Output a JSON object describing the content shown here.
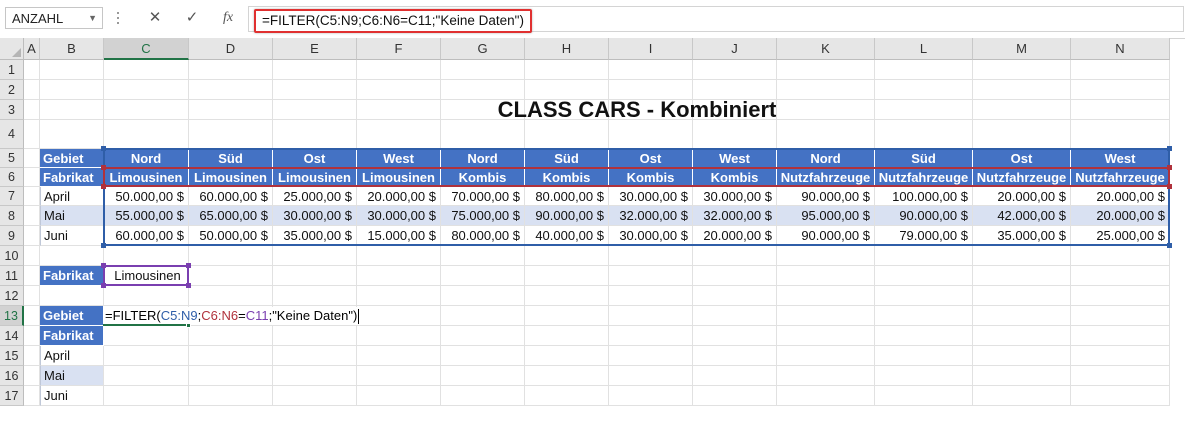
{
  "formula_bar": {
    "name_box": "ANZAHL",
    "cancel_glyph": "✕",
    "enter_glyph": "✓",
    "fx_label": "fx",
    "formula": "=FILTER(C5:N9;C6:N6=C11;\"Keine Daten\")"
  },
  "columns": [
    "A",
    "B",
    "C",
    "D",
    "E",
    "F",
    "G",
    "H",
    "I",
    "J",
    "K",
    "L",
    "M",
    "N"
  ],
  "rows": [
    "1",
    "2",
    "3",
    "4",
    "5",
    "6",
    "7",
    "8",
    "9",
    "10",
    "11",
    "12",
    "13",
    "14",
    "15",
    "16",
    "17"
  ],
  "title": "CLASS CARS - Kombiniert",
  "table": {
    "gebiet_label": "Gebiet",
    "fabrikat_label": "Fabrikat",
    "gebiete": [
      "Nord",
      "Süd",
      "Ost",
      "West",
      "Nord",
      "Süd",
      "Ost",
      "West",
      "Nord",
      "Süd",
      "Ost",
      "West"
    ],
    "fabrikate": [
      "Limousinen",
      "Limousinen",
      "Limousinen",
      "Limousinen",
      "Kombis",
      "Kombis",
      "Kombis",
      "Kombis",
      "Nutzfahrzeuge",
      "Nutzfahrzeuge",
      "Nutzfahrzeuge",
      "Nutzfahrzeuge"
    ],
    "data": [
      {
        "month": "April",
        "values": [
          "50.000,00 $",
          "60.000,00 $",
          "25.000,00 $",
          "20.000,00 $",
          "70.000,00 $",
          "80.000,00 $",
          "30.000,00 $",
          "30.000,00 $",
          "90.000,00 $",
          "100.000,00 $",
          "20.000,00 $",
          "20.000,00 $"
        ]
      },
      {
        "month": "Mai",
        "values": [
          "55.000,00 $",
          "65.000,00 $",
          "30.000,00 $",
          "30.000,00 $",
          "75.000,00 $",
          "90.000,00 $",
          "32.000,00 $",
          "32.000,00 $",
          "95.000,00 $",
          "90.000,00 $",
          "42.000,00 $",
          "20.000,00 $"
        ]
      },
      {
        "month": "Juni",
        "values": [
          "60.000,00 $",
          "50.000,00 $",
          "35.000,00 $",
          "15.000,00 $",
          "80.000,00 $",
          "40.000,00 $",
          "30.000,00 $",
          "20.000,00 $",
          "90.000,00 $",
          "79.000,00 $",
          "35.000,00 $",
          "25.000,00 $"
        ]
      }
    ]
  },
  "criteria": {
    "label": "Fabrikat",
    "value": "Limousinen"
  },
  "result": {
    "gebiet_label": "Gebiet",
    "fabrikat_label": "Fabrikat",
    "months": [
      "April",
      "Mai",
      "Juni"
    ],
    "edit_parts": {
      "p1": "=FILTER(",
      "p2": "C5:N9",
      "p3": ";",
      "p4": "C6:N6",
      "p5": "=",
      "p6": "C11",
      "p7": ";\"Keine Daten\")"
    }
  },
  "colors": {
    "header_blue": "#4472c4",
    "band": "#d9e1f2",
    "range_blue": "#2f5ea8",
    "range_red": "#b0323c",
    "range_purple": "#7a3fb0",
    "excel_green": "#217346"
  }
}
